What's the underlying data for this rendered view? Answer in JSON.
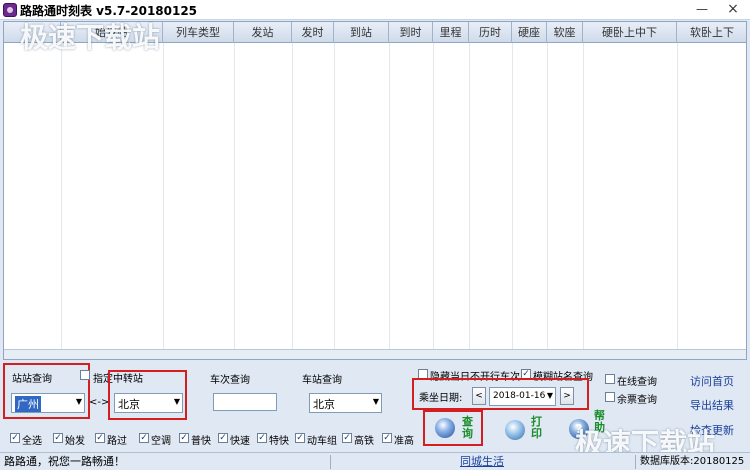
{
  "window": {
    "title": "路路通时刻表 v5.7-20180125",
    "minimize_glyph": "—",
    "close_glyph": "×"
  },
  "watermark": {
    "text": "极速下载站"
  },
  "grid": {
    "columns": [
      "",
      "始发站",
      "列车类型",
      "发站",
      "发时",
      "到站",
      "到时",
      "里程",
      "历时",
      "硬座",
      "软座",
      "硬卧上中下",
      "软卧上下"
    ]
  },
  "station_query": {
    "group_label": "站站查询",
    "transfer_label": "指定中转站",
    "from_value": "广州",
    "swap_label": "<->",
    "to_value": "北京"
  },
  "train_query": {
    "group_label": "车次查询",
    "value": ""
  },
  "stop_query": {
    "group_label": "车站查询",
    "value": "北京"
  },
  "options": {
    "hide_not_running": "隐藏当日不开行车次",
    "hide_not_running_checked": false,
    "fuzzy_station": "模糊站名查询",
    "fuzzy_station_checked": true,
    "online_query": "在线查询",
    "online_query_checked": false,
    "ticket_query": "余票查询",
    "ticket_query_checked": false
  },
  "date": {
    "label": "乘坐日期:",
    "prev": "<",
    "value": "2018-01-16",
    "next": ">"
  },
  "buttons": {
    "query": [
      "查",
      "询"
    ],
    "print": [
      "打",
      "印"
    ],
    "help": [
      "帮",
      "助"
    ]
  },
  "links": {
    "visit_home": "访问首页",
    "export": "导出结果",
    "check_update": "检查更新"
  },
  "train_types": [
    {
      "label": "全选",
      "checked": true
    },
    {
      "label": "始发",
      "checked": true
    },
    {
      "label": "路过",
      "checked": true
    },
    {
      "label": "空调",
      "checked": true
    },
    {
      "label": "普快",
      "checked": true
    },
    {
      "label": "快速",
      "checked": true
    },
    {
      "label": "特快",
      "checked": true
    },
    {
      "label": "动车组",
      "checked": true
    },
    {
      "label": "高铁",
      "checked": true
    },
    {
      "label": "准高",
      "checked": true
    }
  ],
  "statusbar": {
    "message": "路路通，祝您一路畅通！",
    "center_link": "同城生活",
    "db_version": "数据库版本:20180125"
  },
  "colors": {
    "highlight_red": "#d31f1f",
    "link_blue": "#1b3f9c",
    "button_green": "#1a8c2a"
  }
}
